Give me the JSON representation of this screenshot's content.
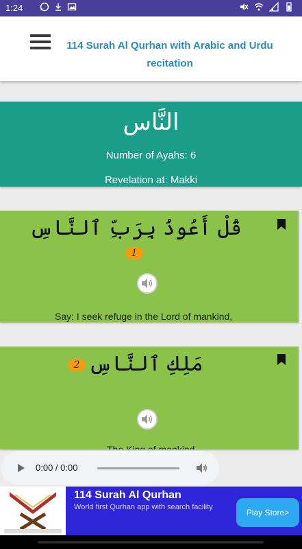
{
  "status": {
    "time": "1:24",
    "battery_level": 0.7
  },
  "appbar": {
    "title": "114 Surah Al Qurhan with Arabic and Urdu recitation",
    "menu_icon": "hamburger-menu-icon"
  },
  "surah": {
    "name_arabic": "النَّاس",
    "ayahs": "Number of Ayahs: 6",
    "revelation": "Revelation at: Makki"
  },
  "ayahs": [
    {
      "number": "1",
      "arabic": "قُلْ أَعُوذُ بِرَبِّ ٱلنَّاسِ",
      "translation": "Say: I seek refuge in the Lord of mankind,"
    },
    {
      "number": "2",
      "arabic": "مَلِكِ ٱلنَّاسِ",
      "translation": "The King of mankind,"
    }
  ],
  "player": {
    "time": "0:00 / 0:00"
  },
  "ad": {
    "title": "114 Surah Al Qurhan",
    "subtitle": "World first Qurhan app with search facility",
    "button": "Play Store>"
  },
  "colors": {
    "statusbar": "#4a3e9b",
    "surah_card": "#1a9e8a",
    "ayah_card": "#8bc34a",
    "title_blue": "#2a8bbf",
    "ad_bg": "#2e24d8",
    "ad_button": "#2ea8f0"
  }
}
